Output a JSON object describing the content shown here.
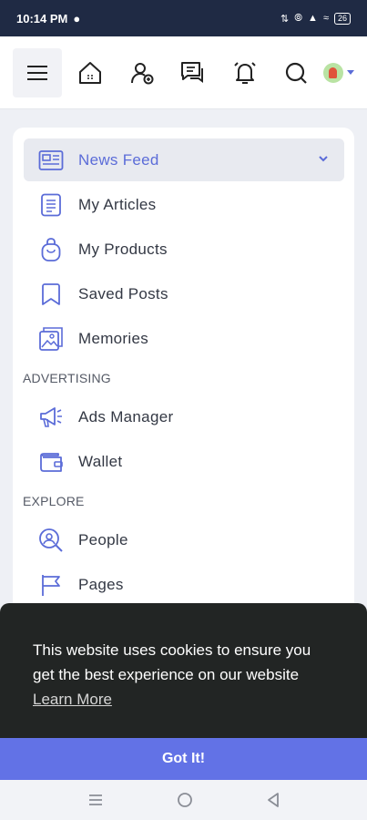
{
  "status_bar": {
    "time": "10:14 PM",
    "battery": "26"
  },
  "nav": {
    "icons": [
      "menu-icon",
      "home-icon",
      "add-user-icon",
      "messages-icon",
      "notifications-icon",
      "search-icon",
      "avatar"
    ]
  },
  "sidebar": {
    "items": [
      {
        "label": "News Feed",
        "icon": "news-feed-icon",
        "active": true
      },
      {
        "label": "My Articles",
        "icon": "articles-icon"
      },
      {
        "label": "My Products",
        "icon": "products-icon"
      },
      {
        "label": "Saved Posts",
        "icon": "bookmark-icon"
      },
      {
        "label": "Memories",
        "icon": "memories-icon"
      }
    ],
    "advertising_heading": "ADVERTISING",
    "advertising_items": [
      {
        "label": "Ads Manager",
        "icon": "megaphone-icon"
      },
      {
        "label": "Wallet",
        "icon": "wallet-icon"
      }
    ],
    "explore_heading": "EXPLORE",
    "explore_items": [
      {
        "label": "People",
        "icon": "people-search-icon"
      },
      {
        "label": "Pages",
        "icon": "flag-icon"
      }
    ]
  },
  "cookie": {
    "message": "This website uses cookies to ensure you get the best experience on our website",
    "learn_more": "Learn More",
    "button": "Got It!"
  },
  "colors": {
    "accent": "#5b6cd8",
    "button": "#6272e6",
    "banner": "#222524",
    "status_bar": "#1f2a44"
  }
}
